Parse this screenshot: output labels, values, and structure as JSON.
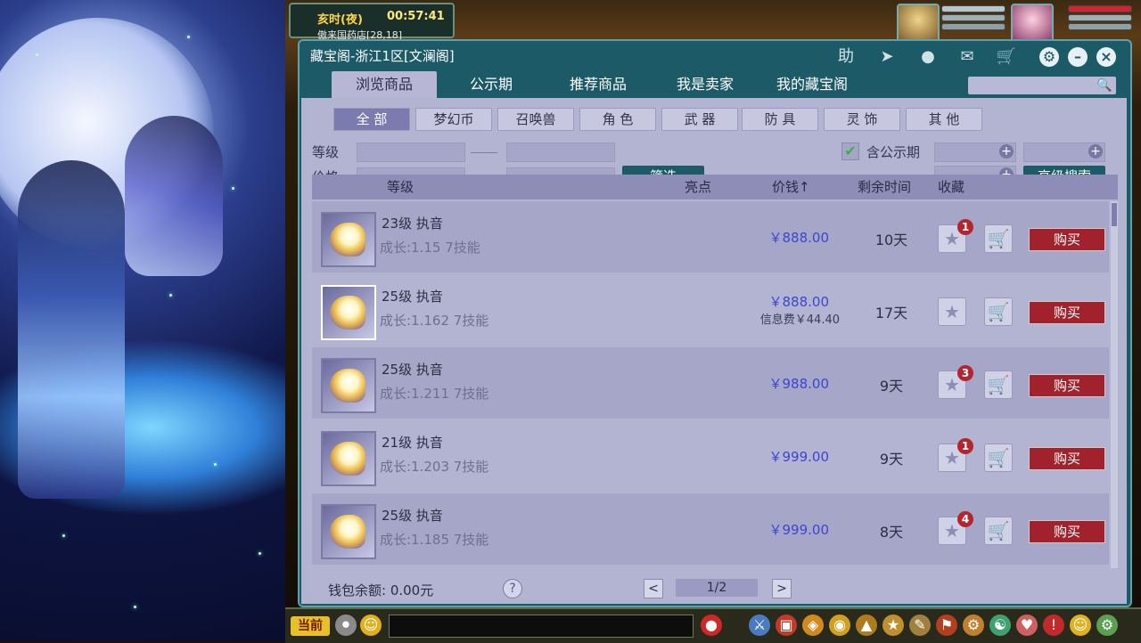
{
  "game": {
    "time_label": "亥时(夜)",
    "time_value": "00:57:41",
    "location": "傲来国药店[28,18]"
  },
  "dialog": {
    "title": "藏宝阁-浙江1区[文澜阁]",
    "help_label": "助",
    "tabs": [
      "浏览商品",
      "公示期",
      "推荐商品",
      "我是卖家",
      "我的藏宝阁"
    ],
    "active_tab": "浏览商品",
    "search": {
      "placeholder": ""
    }
  },
  "categories": [
    "全 部",
    "梦幻币",
    "召唤兽",
    "角 色",
    "武 器",
    "防 具",
    "灵 饰",
    "其 他"
  ],
  "filters": {
    "level_label": "等级",
    "price_label": "价格",
    "filter_button": "筛选",
    "include_public_label": "含公示期",
    "include_public_checked": true,
    "advanced_search": "高级搜索"
  },
  "table": {
    "headers": {
      "level": "等级",
      "highlight": "亮点",
      "price": "价钱",
      "time_left": "剩余时间",
      "favorite": "收藏"
    },
    "rows": [
      {
        "name": "23级 执音",
        "info": "成长:1.15 7技能",
        "price": "￥888.00",
        "fee": "",
        "time": "10天",
        "fav_count": "1",
        "buy": "购买"
      },
      {
        "name": "25级 执音",
        "info": "成长:1.162 7技能",
        "price": "￥888.00",
        "fee": "信息费￥44.40",
        "time": "17天",
        "fav_count": "",
        "buy": "购买"
      },
      {
        "name": "25级 执音",
        "info": "成长:1.211 7技能",
        "price": "￥988.00",
        "fee": "",
        "time": "9天",
        "fav_count": "3",
        "buy": "购买"
      },
      {
        "name": "21级 执音",
        "info": "成长:1.203 7技能",
        "price": "￥999.00",
        "fee": "",
        "time": "9天",
        "fav_count": "1",
        "buy": "购买"
      },
      {
        "name": "25级 执音",
        "info": "成长:1.185 7技能",
        "price": "￥999.00",
        "fee": "",
        "time": "8天",
        "fav_count": "4",
        "buy": "购买"
      }
    ]
  },
  "footer": {
    "wallet": "钱包余额: 0.00元",
    "help": "?",
    "page": "1/2",
    "prev": "<",
    "next": ">"
  },
  "bottombar": {
    "current_channel": "当前"
  },
  "colors": {
    "dialog_teal": "#1c5a68",
    "panel_lavender": "#b3b3d2",
    "price_blue": "#3b46d1",
    "buy_red": "#a1222c",
    "badge_red": "#b2262f"
  }
}
